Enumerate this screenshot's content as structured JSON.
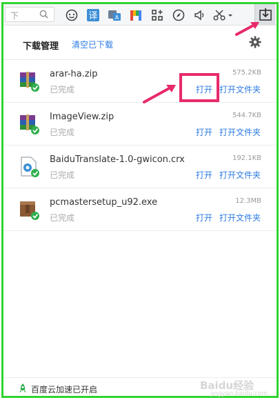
{
  "toolbar": {
    "search_text": "下",
    "icons": [
      "search-icon",
      "emoji-icon",
      "translate-icon",
      "text-translate-icon",
      "color-m-icon",
      "apps-grid-icon",
      "compass-icon",
      "speaker-icon",
      "scissors-icon",
      "download-icon"
    ]
  },
  "header": {
    "title": "下载管理",
    "clear_label": "清空已下载"
  },
  "downloads": [
    {
      "name": "arar-ha.zip",
      "size": "575.2KB",
      "status": "已完成",
      "open": "打开",
      "open_folder": "打开文件夹",
      "icon": "winrar-icon"
    },
    {
      "name": "ImageView.zip",
      "size": "544.7KB",
      "status": "已完成",
      "open": "打开",
      "open_folder": "打开文件夹",
      "icon": "winrar-icon"
    },
    {
      "name": "BaiduTranslate-1.0-gwicon.crx",
      "size": "192.1KB",
      "status": "已完成",
      "open": "打开",
      "open_folder": "打开文件夹",
      "icon": "crx-icon"
    },
    {
      "name": "pcmastersetup_u92.exe",
      "size": "12.3MB",
      "status": "已完成",
      "open": "打开",
      "open_folder": "打开文件夹",
      "icon": "package-icon"
    }
  ],
  "footer": {
    "text": "百度云加速已开启",
    "watermark": "Baidu经验",
    "watermark_sub": "jingyan.baidu.com"
  },
  "colors": {
    "frame": "#2ed42e",
    "accent": "#2c7be5",
    "highlight": "#e8296b"
  }
}
